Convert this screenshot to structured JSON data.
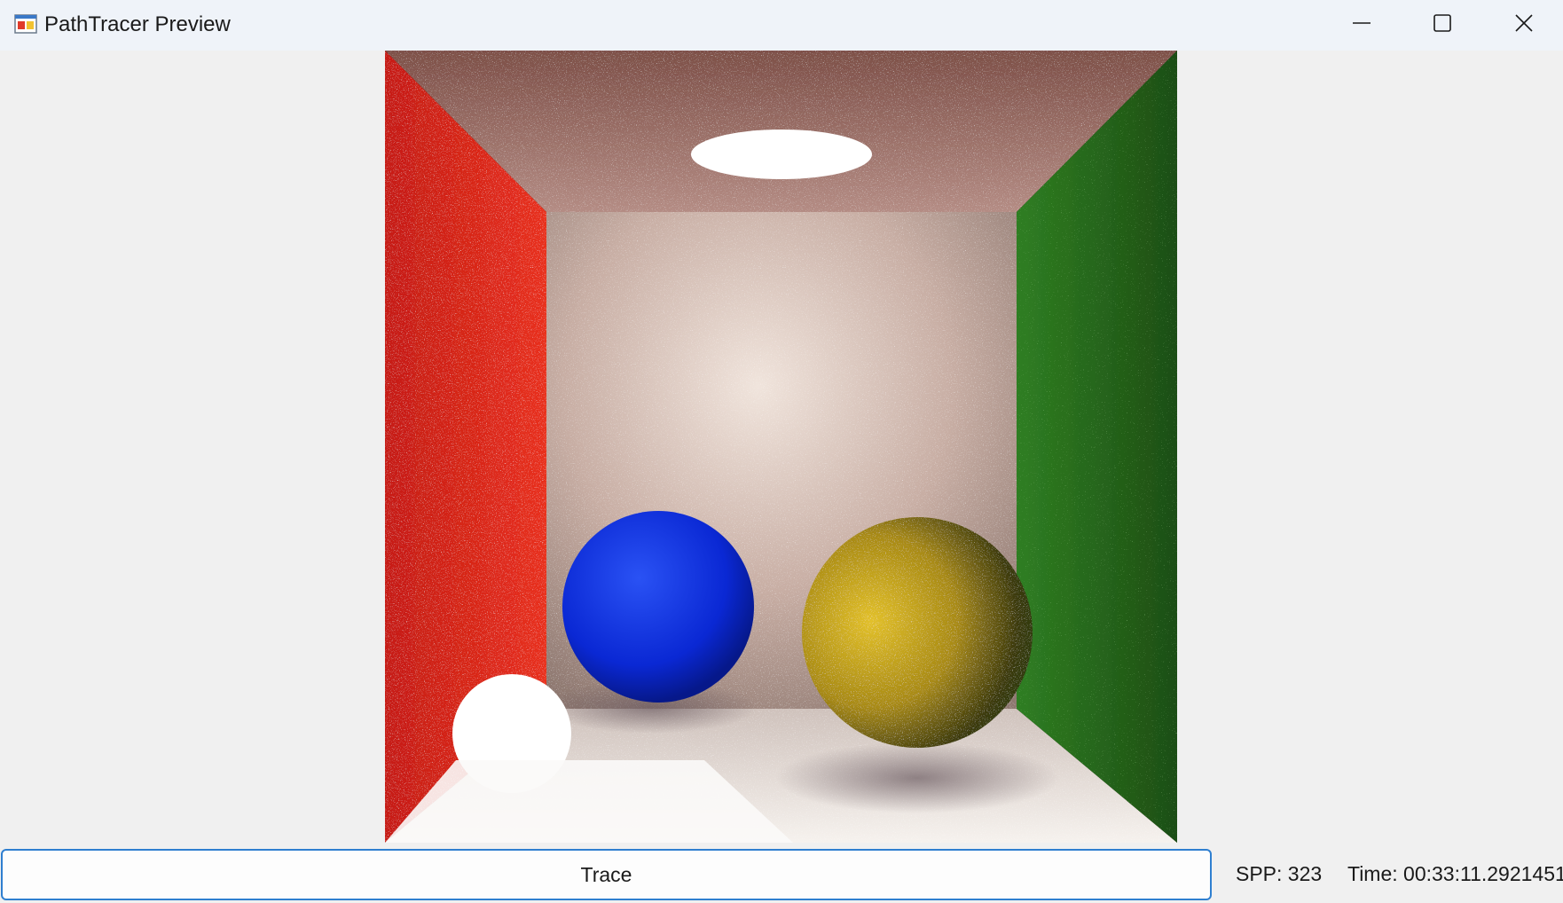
{
  "window": {
    "title": "PathTracer Preview",
    "icon": "app-window-icon",
    "controls": {
      "minimize_icon": "minimize-icon",
      "maximize_icon": "maximize-icon",
      "close_icon": "close-icon"
    }
  },
  "render": {
    "description_icon": "cornell-box-render",
    "colors": {
      "left_wall": "#e0281c",
      "right_wall": "#2a7a1e",
      "back_wall": "#c8b6ac",
      "ceiling": "#9a6a60",
      "floor": "#e8e4e0",
      "light": "#ffffff",
      "blue_sphere": "#0a2ee0",
      "yellow_sphere": "#c8a418",
      "white_sphere": "#ffffff"
    }
  },
  "controls": {
    "trace_label": "Trace"
  },
  "status": {
    "spp": "SPP: 323",
    "time": "Time: 00:33:11.2921451"
  }
}
